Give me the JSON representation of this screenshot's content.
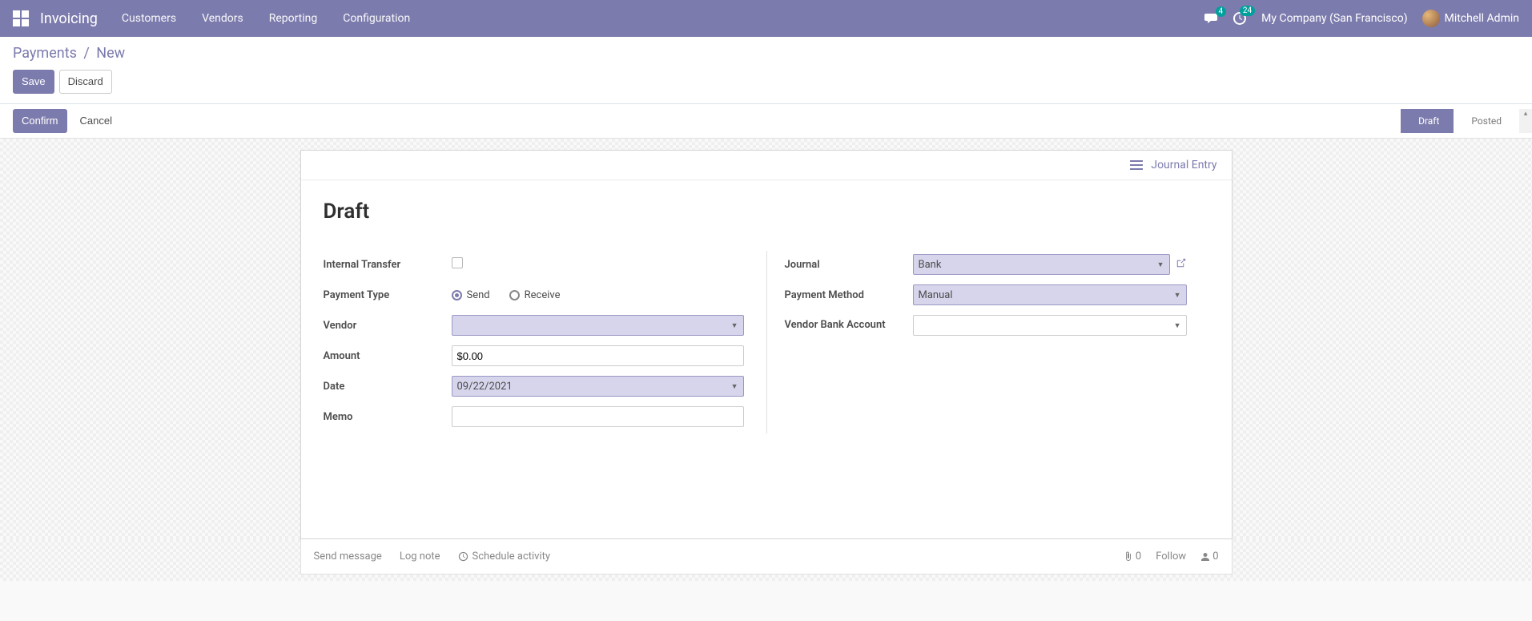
{
  "navbar": {
    "brand": "Invoicing",
    "menu": [
      "Customers",
      "Vendors",
      "Reporting",
      "Configuration"
    ],
    "company": "My Company (San Francisco)",
    "user": "Mitchell Admin",
    "chat_badge": "4",
    "activity_badge": "24"
  },
  "breadcrumb": {
    "parent": "Payments",
    "current": "New"
  },
  "cp_buttons": {
    "save": "Save",
    "discard": "Discard"
  },
  "statusbar": {
    "confirm": "Confirm",
    "cancel": "Cancel",
    "steps": {
      "draft": "Draft",
      "posted": "Posted"
    }
  },
  "sheet": {
    "stat_button": "Journal Entry",
    "title": "Draft",
    "labels": {
      "internal_transfer": "Internal Transfer",
      "payment_type": "Payment Type",
      "vendor": "Vendor",
      "amount": "Amount",
      "date": "Date",
      "memo": "Memo",
      "journal": "Journal",
      "payment_method": "Payment Method",
      "vendor_bank_account": "Vendor Bank Account"
    },
    "values": {
      "internal_transfer": false,
      "payment_type_send": "Send",
      "payment_type_receive": "Receive",
      "payment_type_selected": "send",
      "vendor": "",
      "amount": "$0.00",
      "date": "09/22/2021",
      "memo": "",
      "journal": "Bank",
      "payment_method": "Manual",
      "vendor_bank_account": ""
    }
  },
  "chatter": {
    "send_message": "Send message",
    "log_note": "Log note",
    "schedule_activity": "Schedule activity",
    "attachments": "0",
    "follow": "Follow",
    "followers": "0"
  }
}
